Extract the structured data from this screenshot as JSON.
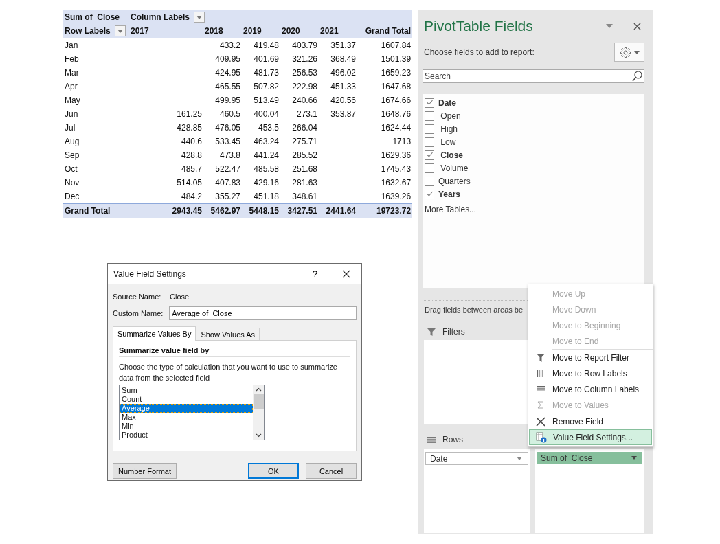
{
  "pivot_table": {
    "value_label": "Sum of  Close",
    "column_labels": "Column Labels",
    "row_labels": "Row Labels",
    "columns": [
      "2017",
      "2018",
      "2019",
      "2020",
      "2021",
      "Grand Total"
    ],
    "rows": [
      {
        "label": "Jan",
        "y2018": "433.2",
        "y2019": "419.48",
        "y2020": "403.79",
        "y2021": "351.37",
        "total": "1607.84"
      },
      {
        "label": "Feb",
        "y2018": "409.95",
        "y2019": "401.69",
        "y2020": "321.26",
        "y2021": "368.49",
        "total": "1501.39"
      },
      {
        "label": "Mar",
        "y2018": "424.95",
        "y2019": "481.73",
        "y2020": "256.53",
        "y2021": "496.02",
        "total": "1659.23"
      },
      {
        "label": "Apr",
        "y2018": "465.55",
        "y2019": "507.82",
        "y2020": "222.98",
        "y2021": "451.33",
        "total": "1647.68"
      },
      {
        "label": "May",
        "y2018": "499.95",
        "y2019": "513.49",
        "y2020": "240.66",
        "y2021": "420.56",
        "total": "1674.66"
      },
      {
        "label": "Jun",
        "y2017": "161.25",
        "y2018": "460.5",
        "y2019": "400.04",
        "y2020": "273.1",
        "y2021": "353.87",
        "total": "1648.76"
      },
      {
        "label": "Jul",
        "y2017": "428.85",
        "y2018": "476.05",
        "y2019": "453.5",
        "y2020": "266.04",
        "total": "1624.44"
      },
      {
        "label": "Aug",
        "y2017": "440.6",
        "y2018": "533.45",
        "y2019": "463.24",
        "y2020": "275.71",
        "total": "1713"
      },
      {
        "label": "Sep",
        "y2017": "428.8",
        "y2018": "473.8",
        "y2019": "441.24",
        "y2020": "285.52",
        "total": "1629.36"
      },
      {
        "label": "Oct",
        "y2017": "485.7",
        "y2018": "522.47",
        "y2019": "485.58",
        "y2020": "251.68",
        "total": "1745.43"
      },
      {
        "label": "Nov",
        "y2017": "514.05",
        "y2018": "407.83",
        "y2019": "429.16",
        "y2020": "281.63",
        "total": "1632.67"
      },
      {
        "label": "Dec",
        "y2017": "484.2",
        "y2018": "355.27",
        "y2019": "451.18",
        "y2020": "348.61",
        "total": "1639.26"
      }
    ],
    "grand_total": {
      "label": "Grand Total",
      "y2017": "2943.45",
      "y2018": "5462.97",
      "y2019": "5448.15",
      "y2020": "3427.51",
      "y2021": "2441.64",
      "total": "19723.72"
    }
  },
  "value_field_settings": {
    "title": "Value Field Settings",
    "help": "?",
    "source_name_label": "Source Name:",
    "source_name": "Close",
    "custom_name_label": "Custom Name:",
    "custom_name": "Average of  Close",
    "tabs": [
      {
        "label": "Summarize Values By",
        "selected": true
      },
      {
        "label": "Show Values As",
        "selected": false
      }
    ],
    "heading": "Summarize value field by",
    "description": "Choose the type of calculation that you want to use to summarize data from the selected field",
    "functions": [
      {
        "label": "Sum",
        "selected": false
      },
      {
        "label": "Count",
        "selected": false
      },
      {
        "label": "Average",
        "selected": true
      },
      {
        "label": "Max",
        "selected": false
      },
      {
        "label": "Min",
        "selected": false
      },
      {
        "label": "Product",
        "selected": false
      }
    ],
    "buttons": [
      {
        "label": "Number Format",
        "default": false
      },
      {
        "label": "OK",
        "default": true
      },
      {
        "label": "Cancel",
        "default": false
      }
    ]
  },
  "pivot_fields": {
    "title": "PivotTable Fields",
    "subtitle": "Choose fields to add to report:",
    "search": {
      "placeholder": "Search"
    },
    "fields": [
      {
        "label": "Date",
        "checked": true
      },
      {
        "label": " Open",
        "checked": false
      },
      {
        "label": " High",
        "checked": false
      },
      {
        "label": " Low",
        "checked": false
      },
      {
        "label": " Close",
        "checked": true
      },
      {
        "label": " Volume",
        "checked": false
      },
      {
        "label": "Quarters",
        "checked": false
      },
      {
        "label": "Years",
        "checked": true
      }
    ],
    "more_tables": "More Tables...",
    "drag_hint": "Drag fields between areas be",
    "filters_label": "Filters",
    "rows_label": "Rows",
    "rows_items": [
      {
        "label": "Date"
      }
    ],
    "values_items": [
      {
        "label": "Sum of  Close",
        "selected": true
      }
    ]
  },
  "context_menu": {
    "items": [
      {
        "label": "Move Up",
        "disabled": true,
        "selected": false,
        "separator_before": false
      },
      {
        "label": "Move Down",
        "disabled": true,
        "selected": false,
        "separator_before": false
      },
      {
        "label": "Move to Beginning",
        "disabled": true,
        "selected": false,
        "separator_before": false
      },
      {
        "label": "Move to End",
        "disabled": true,
        "selected": false,
        "separator_before": false
      },
      {
        "label": "Move to Report Filter",
        "disabled": false,
        "selected": false,
        "separator_before": true
      },
      {
        "label": "Move to Row Labels",
        "disabled": false,
        "selected": false,
        "separator_before": false
      },
      {
        "label": "Move to Column Labels",
        "disabled": false,
        "selected": false,
        "separator_before": false
      },
      {
        "label": "Move to Values",
        "disabled": true,
        "selected": false,
        "separator_before": false
      },
      {
        "label": "Remove Field",
        "disabled": false,
        "selected": false,
        "separator_before": true
      },
      {
        "label": "Value Field Settings...",
        "disabled": false,
        "selected": true,
        "separator_before": false
      }
    ]
  }
}
